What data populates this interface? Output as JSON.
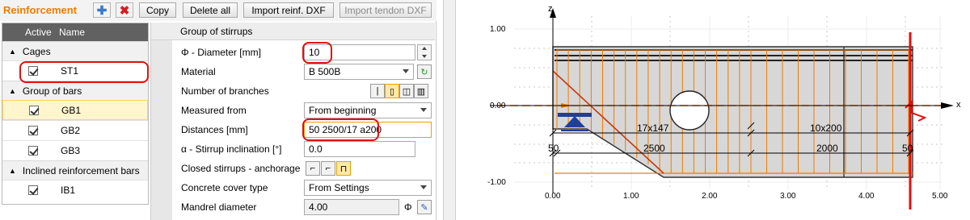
{
  "toolbar": {
    "title": "Reinforcement",
    "copy": "Copy",
    "delete_all": "Delete all",
    "import_reinf_dxf": "Import reinf. DXF",
    "import_tendon_dxf": "Import tendon DXF"
  },
  "tree": {
    "col_active": "Active",
    "col_name": "Name",
    "groups": [
      {
        "label": "Cages",
        "items": [
          "ST1"
        ]
      },
      {
        "label": "Group of bars",
        "items": [
          "GB1",
          "GB2",
          "GB3"
        ]
      },
      {
        "label": "Inclined reinforcement bars",
        "items": [
          "IB1"
        ]
      }
    ]
  },
  "props": {
    "header": "Group of stirrups",
    "rows": [
      {
        "label": "Φ - Diameter [mm]",
        "value": "10"
      },
      {
        "label": "Material",
        "value": "B 500B"
      },
      {
        "label": "Number of branches",
        "value": ""
      },
      {
        "label": "Measured from",
        "value": "From beginning"
      },
      {
        "label": "Distances [mm]",
        "value": "50 2500/17 a200"
      },
      {
        "label": "α - Stirrup inclination [°]",
        "value": "0.0"
      },
      {
        "label": "Closed stirrups - anchorage",
        "value": ""
      },
      {
        "label": "Concrete cover type",
        "value": "From Settings"
      },
      {
        "label": "Mandrel diameter",
        "value": "4.00"
      }
    ],
    "mandrel_unit": "Φ"
  },
  "drawing": {
    "axis_z": "z",
    "axis_x": "x",
    "y_ticks": [
      "1.00",
      "0.00",
      "-1.00"
    ],
    "x_ticks": [
      "0.00",
      "1.00",
      "2.00",
      "3.00",
      "4.00",
      "5.00"
    ],
    "dim_labels": {
      "seg1_count": "17x147",
      "seg2_count": "10x200",
      "d1": "50",
      "d2": "2500",
      "d3": "2000",
      "d4": "50"
    },
    "colors": {
      "stirrup": "#f07c00",
      "highlight": "#e21010",
      "support": "#1f3f99"
    }
  }
}
